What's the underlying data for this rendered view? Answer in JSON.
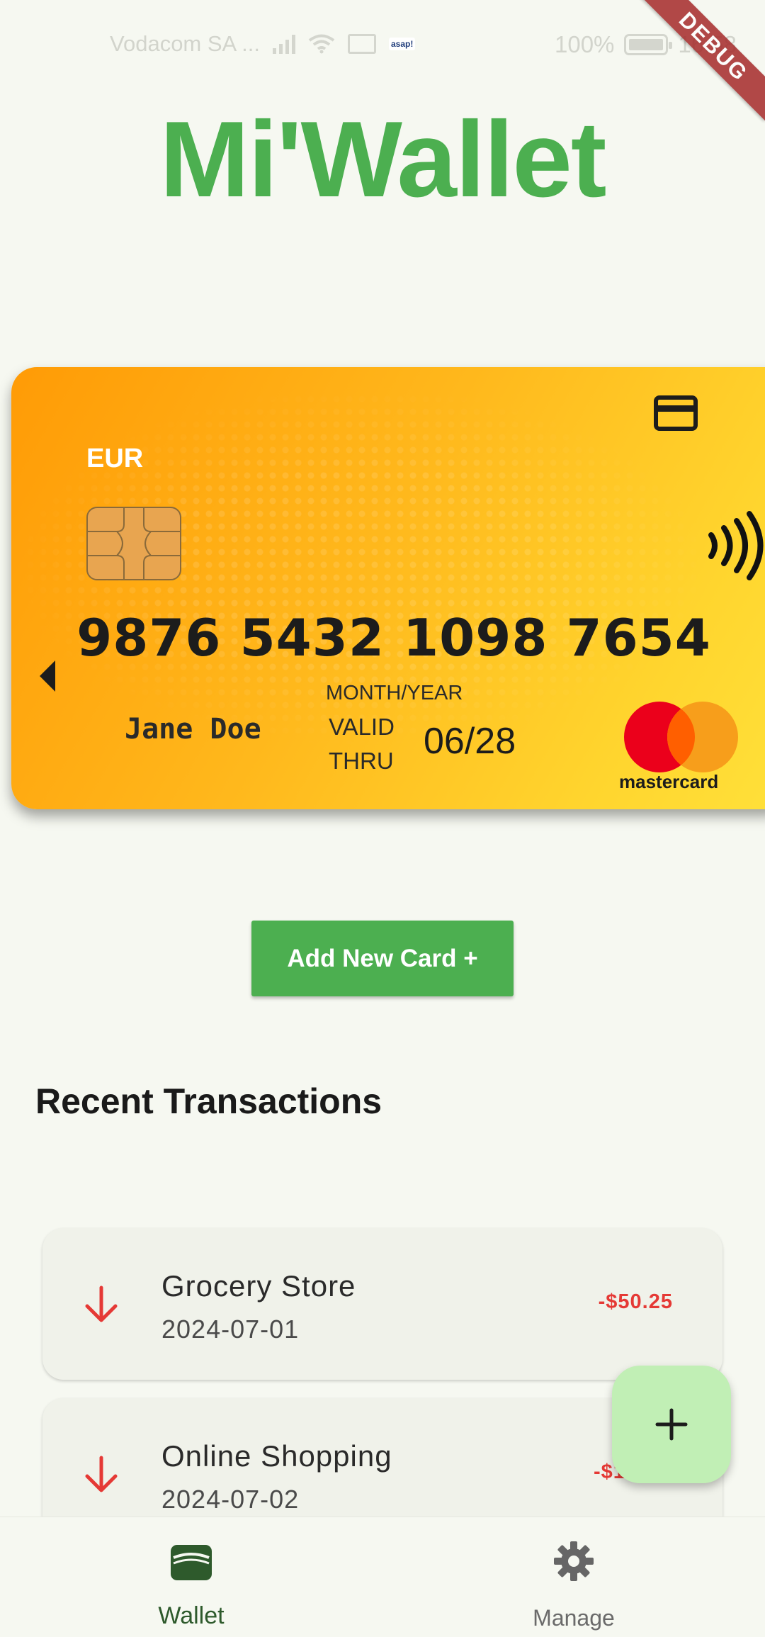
{
  "status_bar": {
    "carrier": "Vodacom SA ...",
    "notification_badge": "asap!",
    "battery": "100%",
    "time": "16:58"
  },
  "debug_banner": "DEBUG",
  "app_title": "Mi'Wallet",
  "card": {
    "currency": "EUR",
    "number": "9876 5432 1098 7654",
    "holder": "Jane  Doe",
    "month_year_label": "MONTH/YEAR",
    "valid_label": "VALID",
    "thru_label": "THRU",
    "expiry": "06/28",
    "brand": "mastercard",
    "colors": {
      "gradient_start": "#ff9b06",
      "gradient_end": "#ffe13a"
    }
  },
  "add_card_button": "Add New Card +",
  "transactions_section": {
    "title": "Recent Transactions",
    "items": [
      {
        "title": "Grocery Store",
        "date": "2024-07-01",
        "amount": "-$50.25",
        "icon": "arrow-down-icon"
      },
      {
        "title": "Online Shopping",
        "date": "2024-07-02",
        "amount": "-$12",
        "icon": "arrow-down-icon"
      }
    ]
  },
  "fab": {
    "icon": "plus-icon"
  },
  "bottom_nav": {
    "items": [
      {
        "label": "Wallet",
        "icon": "wallet-icon",
        "active": true
      },
      {
        "label": "Manage",
        "icon": "gear-icon",
        "active": false
      }
    ]
  },
  "theme": {
    "primary": "#4caf50",
    "negative": "#e53935",
    "background": "#f6f8f1",
    "fab": "#c1efb5"
  }
}
